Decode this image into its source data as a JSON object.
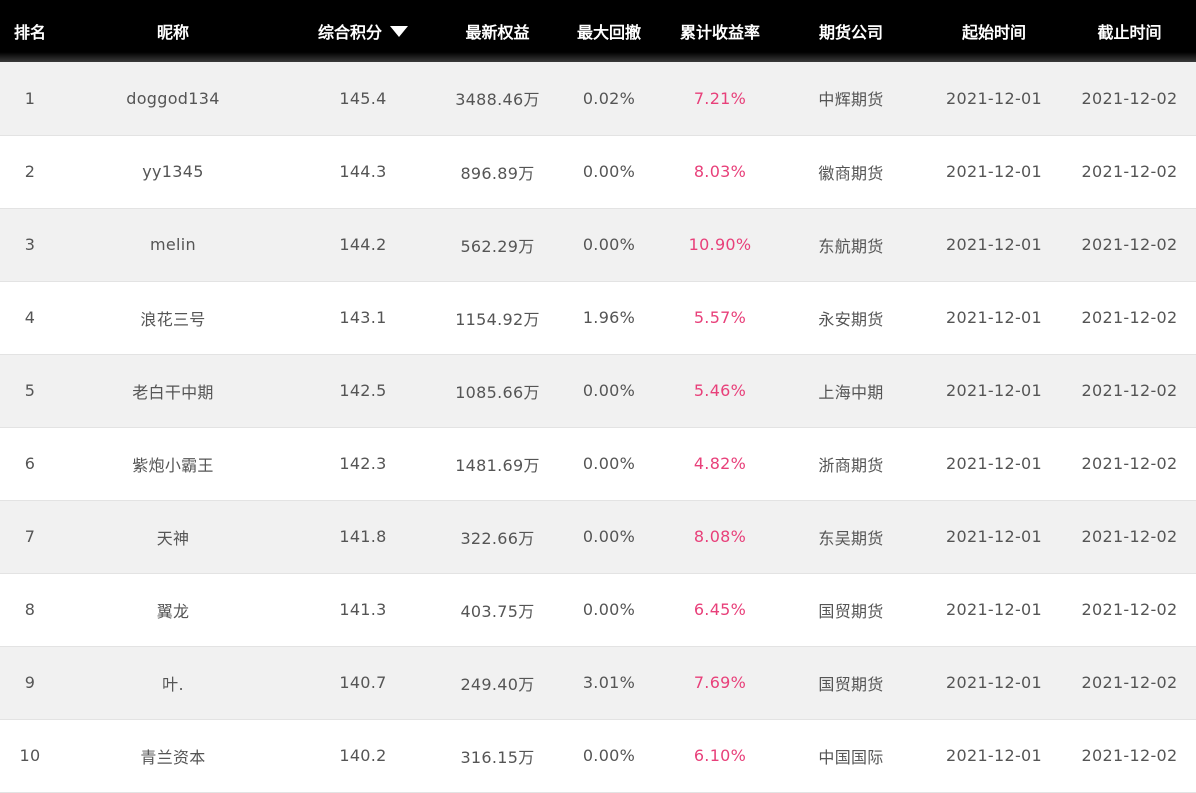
{
  "headers": {
    "rank": "排名",
    "nickname": "昵称",
    "score": "综合积分",
    "equity": "最新权益",
    "drawdown": "最大回撤",
    "return_rate": "累计收益率",
    "company": "期货公司",
    "start": "起始时间",
    "end": "截止时间"
  },
  "sort": {
    "column": "score",
    "direction": "desc",
    "icon": "caret-down-icon"
  },
  "colors": {
    "header_bg": "#000000",
    "row_alt": "#f1f1f1",
    "rate": "#e8407a",
    "text": "#555555"
  },
  "rows": [
    {
      "rank": "1",
      "nickname": "doggod134",
      "score": "145.4",
      "equity": "3488.46万",
      "drawdown": "0.02%",
      "return_rate": "7.21%",
      "company": "中辉期货",
      "start": "2021-12-01",
      "end": "2021-12-02"
    },
    {
      "rank": "2",
      "nickname": "yy1345",
      "score": "144.3",
      "equity": "896.89万",
      "drawdown": "0.00%",
      "return_rate": "8.03%",
      "company": "徽商期货",
      "start": "2021-12-01",
      "end": "2021-12-02"
    },
    {
      "rank": "3",
      "nickname": "melin",
      "score": "144.2",
      "equity": "562.29万",
      "drawdown": "0.00%",
      "return_rate": "10.90%",
      "company": "东航期货",
      "start": "2021-12-01",
      "end": "2021-12-02"
    },
    {
      "rank": "4",
      "nickname": "浪花三号",
      "score": "143.1",
      "equity": "1154.92万",
      "drawdown": "1.96%",
      "return_rate": "5.57%",
      "company": "永安期货",
      "start": "2021-12-01",
      "end": "2021-12-02"
    },
    {
      "rank": "5",
      "nickname": "老白干中期",
      "score": "142.5",
      "equity": "1085.66万",
      "drawdown": "0.00%",
      "return_rate": "5.46%",
      "company": "上海中期",
      "start": "2021-12-01",
      "end": "2021-12-02"
    },
    {
      "rank": "6",
      "nickname": "紫炮小霸王",
      "score": "142.3",
      "equity": "1481.69万",
      "drawdown": "0.00%",
      "return_rate": "4.82%",
      "company": "浙商期货",
      "start": "2021-12-01",
      "end": "2021-12-02"
    },
    {
      "rank": "7",
      "nickname": "天神",
      "score": "141.8",
      "equity": "322.66万",
      "drawdown": "0.00%",
      "return_rate": "8.08%",
      "company": "东吴期货",
      "start": "2021-12-01",
      "end": "2021-12-02"
    },
    {
      "rank": "8",
      "nickname": "翼龙",
      "score": "141.3",
      "equity": "403.75万",
      "drawdown": "0.00%",
      "return_rate": "6.45%",
      "company": "国贸期货",
      "start": "2021-12-01",
      "end": "2021-12-02"
    },
    {
      "rank": "9",
      "nickname": "叶.",
      "score": "140.7",
      "equity": "249.40万",
      "drawdown": "3.01%",
      "return_rate": "7.69%",
      "company": "国贸期货",
      "start": "2021-12-01",
      "end": "2021-12-02"
    },
    {
      "rank": "10",
      "nickname": "青兰资本",
      "score": "140.2",
      "equity": "316.15万",
      "drawdown": "0.00%",
      "return_rate": "6.10%",
      "company": "中国国际",
      "start": "2021-12-01",
      "end": "2021-12-02"
    }
  ]
}
